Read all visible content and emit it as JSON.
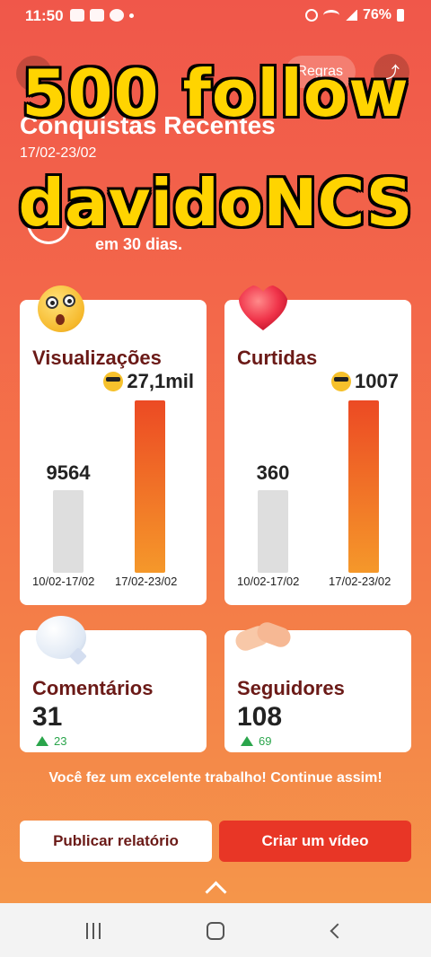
{
  "status_bar": {
    "time": "11:50",
    "battery": "76%"
  },
  "header": {
    "rules_label": "Regras",
    "title": "Conquistas Recentes",
    "date_range": "17/02-23/02",
    "summary_text": "em 30 dias."
  },
  "overlay": {
    "line1": "500 follow",
    "line2": "davidoNCS"
  },
  "views_card": {
    "title": "Visualizações",
    "peak": "27,1mil",
    "prev_value": "9564",
    "prev_label": "10/02-17/02",
    "curr_label": "17/02-23/02"
  },
  "likes_card": {
    "title": "Curtidas",
    "peak": "1007",
    "prev_value": "360",
    "prev_label": "10/02-17/02",
    "curr_label": "17/02-23/02"
  },
  "comments_card": {
    "title": "Comentários",
    "value": "31",
    "delta": "23"
  },
  "followers_card": {
    "title": "Seguidores",
    "value": "108",
    "delta": "69"
  },
  "encouragement": "Você fez um excelente trabalho! Continue assim!",
  "buttons": {
    "publish": "Publicar relatório",
    "create": "Criar um vídeo"
  },
  "colors": {
    "accent": "#e83626",
    "title_text": "#6b1a17",
    "increase": "#2aa54b"
  }
}
